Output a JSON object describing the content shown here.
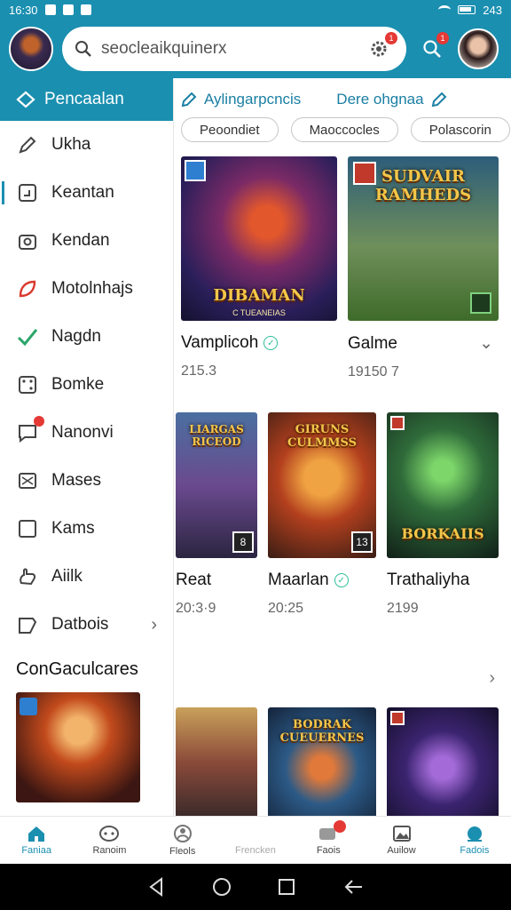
{
  "status_bar": {
    "time": "16:30",
    "right": "243"
  },
  "header": {
    "search_text": "seocleaikquinerx",
    "settings_badge": "1",
    "search_badge": "1"
  },
  "sidebar": {
    "header_label": "Pencaalan",
    "items": [
      {
        "label": "Ukha",
        "icon": "pencil-icon"
      },
      {
        "label": "Keantan",
        "icon": "frame-icon"
      },
      {
        "label": "Kendan",
        "icon": "camera-icon"
      },
      {
        "label": "Motolnhajs",
        "icon": "leaf-icon"
      },
      {
        "label": "Nagdn",
        "icon": "check-icon"
      },
      {
        "label": "Bomke",
        "icon": "dice-icon"
      },
      {
        "label": "Nanonvi",
        "icon": "chat-icon"
      },
      {
        "label": "Mases",
        "icon": "mail-icon"
      },
      {
        "label": "Kams",
        "icon": "square-icon"
      },
      {
        "label": "Aiilk",
        "icon": "hand-icon"
      },
      {
        "label": "Datbois",
        "icon": "tag-icon"
      }
    ],
    "section_title": "ConGaculcares"
  },
  "main": {
    "categories": [
      "Aylingarpcncis",
      "Dere ohgnaa"
    ],
    "chips": [
      "Peoondiet",
      "Maoccocles",
      "Polascorin"
    ],
    "row1": [
      {
        "name": "Vamplicoh",
        "meta": "215.3",
        "art_title": "DIBAMAN",
        "art_sub": "C TUEANEIAS"
      },
      {
        "name": "Galme",
        "meta": "19150 7",
        "art_title": "SUDVAIR RAMHEDS",
        "art_sub": ""
      }
    ],
    "row2": [
      {
        "name": "Reat",
        "meta": "20:3·9",
        "art_title": "LIARGAS RICEOD",
        "corner": "8"
      },
      {
        "name": "Maarlan",
        "meta": "20:25",
        "art_title": "GIRUNS CULMMSS",
        "corner": "13"
      },
      {
        "name": "Trathaliyha",
        "meta": "2199",
        "art_title": "BORKAIIS",
        "corner": ""
      }
    ],
    "row3": [
      {
        "art_title": ""
      },
      {
        "art_title": "BODRAK CUEUERNES"
      },
      {
        "art_title": ""
      }
    ]
  },
  "bottom_nav": [
    {
      "label": "Faniaa",
      "icon": "home-icon"
    },
    {
      "label": "Ranoim",
      "icon": "gamepad-icon"
    },
    {
      "label": "Fleols",
      "icon": "person-icon"
    },
    {
      "label": "Frencken",
      "icon": "blank-icon"
    },
    {
      "label": "Faois",
      "icon": "ticket-icon"
    },
    {
      "label": "Auilow",
      "icon": "photo-icon"
    },
    {
      "label": "Fadois",
      "icon": "chart-icon"
    }
  ],
  "colors": {
    "primary": "#1a8fb0",
    "badge": "#e53935",
    "verified": "#2bbf9a"
  }
}
